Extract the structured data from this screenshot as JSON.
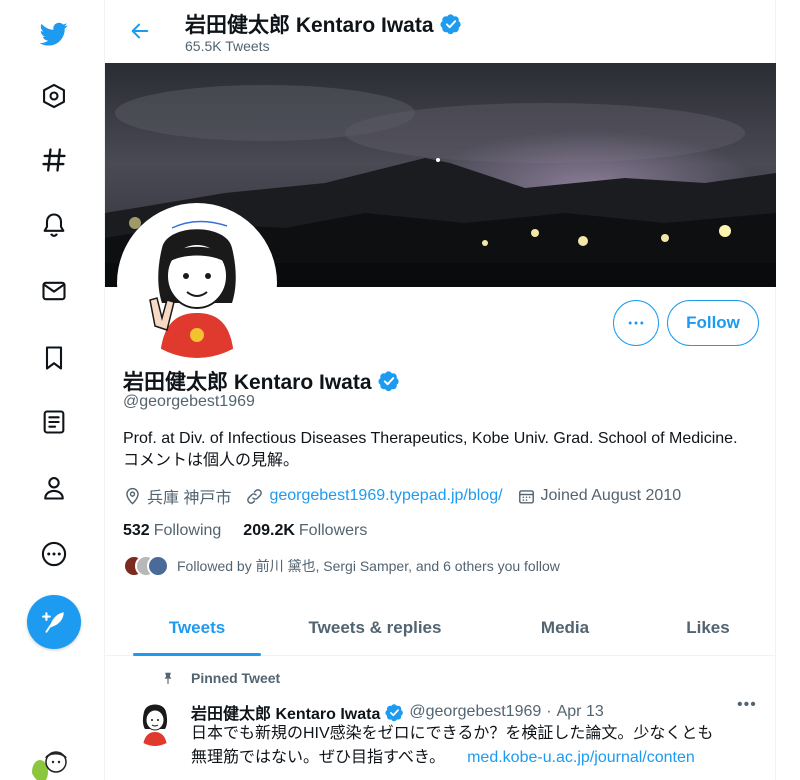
{
  "header": {
    "title": "岩田健太郎 Kentaro Iwata",
    "tweet_count": "65.5K Tweets"
  },
  "sidebar": {
    "items": [
      {
        "name": "twitter-logo"
      },
      {
        "name": "explore"
      },
      {
        "name": "hashtag"
      },
      {
        "name": "notifications"
      },
      {
        "name": "messages"
      },
      {
        "name": "bookmarks"
      },
      {
        "name": "lists"
      },
      {
        "name": "profile"
      },
      {
        "name": "more"
      }
    ]
  },
  "profile": {
    "display_name": "岩田健太郎 Kentaro Iwata",
    "handle": "@georgebest1969",
    "bio": "Prof. at Div. of Infectious Diseases Therapeutics, Kobe Univ. Grad. School of Medicine.　コメントは個人の見解。",
    "location": "兵庫 神戸市",
    "website": "georgebest1969.typepad.jp/blog/",
    "joined": "Joined August 2010",
    "following_count": "532",
    "following_label": "Following",
    "followers_count": "209.2K",
    "followers_label": "Followers",
    "followed_by": "Followed by 前川 黛也, Sergi Samper, and 6 others you follow",
    "follow_label": "Follow",
    "more_label": "•••"
  },
  "tabs": [
    {
      "label": "Tweets"
    },
    {
      "label": "Tweets & replies"
    },
    {
      "label": "Media"
    },
    {
      "label": "Likes"
    }
  ],
  "pinned_tweet": {
    "pinned_label": "Pinned Tweet",
    "author_name": "岩田健太郎 Kentaro Iwata",
    "author_handle": "@georgebest1969",
    "separator": "·",
    "date": "Apr 13",
    "text_line1": "日本でも新規のHIV感染をゼロにできるか？を検証した論文。少なくとも",
    "text_line2": "無理筋ではない。ぜひ目指すべき。",
    "link": "med.kobe-u.ac.jp/journal/conten",
    "more": "•••"
  },
  "colors": {
    "accent": "#1d9bf0",
    "text_primary": "#0f1419",
    "text_secondary": "#536471"
  }
}
